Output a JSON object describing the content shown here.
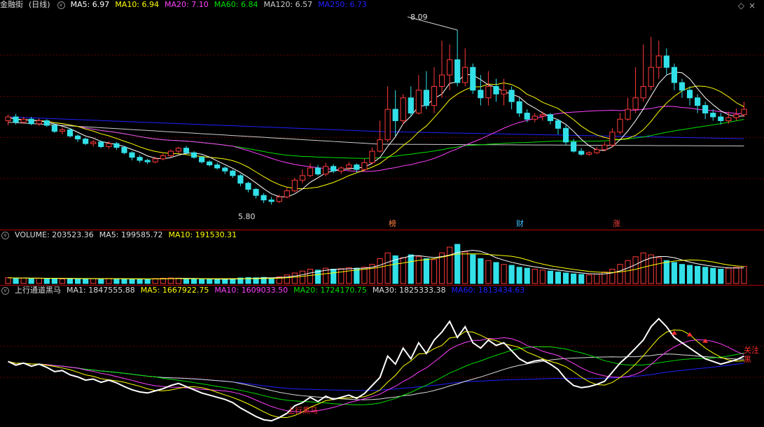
{
  "app": {
    "stock_name": "金融街",
    "period": "(日线)",
    "icon_collapse": "chevron-down-icon",
    "icon_settings": "diamond-icon"
  },
  "colors": {
    "up": "#ff3a3a",
    "down": "#32e0e8",
    "ma5": "#ffffff",
    "ma10": "#ffff00",
    "ma20": "#ff40ff",
    "ma60": "#00e000",
    "ma120": "#cccccc",
    "ma250": "#2020ff",
    "grid": "#6b0000"
  },
  "price_panel": {
    "legend": [
      {
        "key": "MA5",
        "label": "MA5: 6.97",
        "color": "#ffffff"
      },
      {
        "key": "MA10",
        "label": "MA10: 6.94",
        "color": "#ffff00"
      },
      {
        "key": "MA20",
        "label": "MA20: 7.10",
        "color": "#ff40ff"
      },
      {
        "key": "MA60",
        "label": "MA60: 6.84",
        "color": "#00e000"
      },
      {
        "key": "MA120",
        "label": "MA120: 6.57",
        "color": "#cccccc"
      },
      {
        "key": "MA250",
        "label": "MA250: 6.73",
        "color": "#2020ff"
      }
    ],
    "high_label": "8.09",
    "low_label": "5.80",
    "markers": [
      {
        "text": "榜",
        "color": "#ff8040"
      },
      {
        "text": "财",
        "color": "#40c0ff"
      },
      {
        "text": "涨",
        "color": "#ff4040"
      }
    ]
  },
  "volume_panel": {
    "legend": [
      {
        "key": "VOLUME",
        "label": "VOLUME: 203523.36",
        "color": "#dddddd"
      },
      {
        "key": "MA5",
        "label": "MA5: 199585.72",
        "color": "#dddddd"
      },
      {
        "key": "MA10",
        "label": "MA10: 191530.31",
        "color": "#ffff00"
      }
    ]
  },
  "indicator_panel": {
    "name": "上行通道黑马",
    "legend": [
      {
        "key": "MA1",
        "label": "MA1: 1847555.88",
        "color": "#dddddd"
      },
      {
        "key": "MA5",
        "label": "MA5: 1667922.75",
        "color": "#ffff00"
      },
      {
        "key": "MA10",
        "label": "MA10: 1609033.50",
        "color": "#ff40ff"
      },
      {
        "key": "MA20",
        "label": "MA20: 1724170.75",
        "color": "#00e000"
      },
      {
        "key": "MA30",
        "label": "MA30: 1825333.38",
        "color": "#dddddd"
      },
      {
        "key": "MA60",
        "label": "MA60: 1813434.63",
        "color": "#2020ff"
      }
    ],
    "label_left": "上行黑马",
    "label_right": "关注黑"
  },
  "chart_data": {
    "type": "candlestick",
    "price": {
      "ylim": [
        5.6,
        8.3
      ],
      "candles": [
        [
          6.9,
          6.95,
          6.84,
          6.98
        ],
        [
          6.95,
          6.88,
          6.85,
          6.99
        ],
        [
          6.88,
          6.92,
          6.86,
          6.95
        ],
        [
          6.92,
          6.86,
          6.84,
          6.95
        ],
        [
          6.86,
          6.9,
          6.83,
          6.93
        ],
        [
          6.9,
          6.84,
          6.82,
          6.92
        ],
        [
          6.84,
          6.76,
          6.74,
          6.86
        ],
        [
          6.76,
          6.78,
          6.72,
          6.81
        ],
        [
          6.78,
          6.7,
          6.68,
          6.8
        ],
        [
          6.7,
          6.66,
          6.62,
          6.72
        ],
        [
          6.66,
          6.6,
          6.58,
          6.68
        ],
        [
          6.6,
          6.62,
          6.56,
          6.65
        ],
        [
          6.62,
          6.56,
          6.54,
          6.64
        ],
        [
          6.56,
          6.6,
          6.53,
          6.63
        ],
        [
          6.6,
          6.55,
          6.52,
          6.62
        ],
        [
          6.55,
          6.48,
          6.46,
          6.57
        ],
        [
          6.48,
          6.42,
          6.38,
          6.5
        ],
        [
          6.42,
          6.38,
          6.35,
          6.45
        ],
        [
          6.38,
          6.36,
          6.33,
          6.4
        ],
        [
          6.36,
          6.4,
          6.34,
          6.43
        ],
        [
          6.4,
          6.44,
          6.38,
          6.47
        ],
        [
          6.44,
          6.5,
          6.42,
          6.52
        ],
        [
          6.5,
          6.54,
          6.47,
          6.56
        ],
        [
          6.54,
          6.48,
          6.46,
          6.57
        ],
        [
          6.48,
          6.42,
          6.4,
          6.5
        ],
        [
          6.42,
          6.36,
          6.34,
          6.44
        ],
        [
          6.36,
          6.32,
          6.3,
          6.38
        ],
        [
          6.32,
          6.28,
          6.26,
          6.35
        ],
        [
          6.28,
          6.24,
          6.2,
          6.3
        ],
        [
          6.24,
          6.18,
          6.15,
          6.26
        ],
        [
          6.18,
          6.08,
          6.04,
          6.2
        ],
        [
          6.08,
          6.0,
          5.96,
          6.1
        ],
        [
          6.0,
          5.92,
          5.88,
          6.02
        ],
        [
          5.92,
          5.86,
          5.82,
          5.95
        ],
        [
          5.86,
          5.84,
          5.8,
          5.9
        ],
        [
          5.84,
          5.9,
          5.82,
          5.93
        ],
        [
          5.9,
          5.98,
          5.88,
          6.02
        ],
        [
          5.98,
          6.12,
          5.96,
          6.15
        ],
        [
          6.12,
          6.18,
          6.08,
          6.26
        ],
        [
          6.18,
          6.28,
          6.16,
          6.34
        ],
        [
          6.28,
          6.2,
          6.18,
          6.32
        ],
        [
          6.2,
          6.3,
          6.17,
          6.35
        ],
        [
          6.3,
          6.24,
          6.21,
          6.33
        ],
        [
          6.24,
          6.28,
          6.2,
          6.3
        ],
        [
          6.28,
          6.32,
          6.24,
          6.36
        ],
        [
          6.32,
          6.26,
          6.22,
          6.34
        ],
        [
          6.26,
          6.35,
          6.24,
          6.4
        ],
        [
          6.35,
          6.5,
          6.33,
          6.55
        ],
        [
          6.5,
          6.65,
          6.48,
          6.9
        ],
        [
          6.65,
          7.05,
          6.62,
          7.35
        ],
        [
          7.05,
          6.9,
          6.7,
          7.3
        ],
        [
          6.9,
          7.2,
          6.85,
          7.25
        ],
        [
          7.2,
          7.0,
          6.95,
          7.35
        ],
        [
          7.0,
          7.3,
          6.98,
          7.5
        ],
        [
          7.3,
          7.1,
          7.05,
          7.55
        ],
        [
          7.1,
          7.35,
          7.0,
          7.6
        ],
        [
          7.35,
          7.5,
          7.2,
          7.95
        ],
        [
          7.5,
          7.7,
          7.3,
          7.9
        ],
        [
          7.7,
          7.4,
          7.35,
          8.09
        ],
        [
          7.4,
          7.6,
          7.35,
          7.85
        ],
        [
          7.6,
          7.3,
          7.25,
          7.65
        ],
        [
          7.3,
          7.2,
          7.1,
          7.5
        ],
        [
          7.2,
          7.35,
          7.1,
          7.55
        ],
        [
          7.35,
          7.25,
          7.15,
          7.45
        ],
        [
          7.25,
          7.3,
          7.1,
          7.45
        ],
        [
          7.3,
          7.15,
          7.05,
          7.35
        ],
        [
          7.15,
          7.0,
          6.95,
          7.2
        ],
        [
          7.0,
          6.92,
          6.88,
          7.05
        ],
        [
          6.92,
          6.96,
          6.88,
          7.0
        ],
        [
          6.96,
          6.98,
          6.9,
          7.02
        ],
        [
          6.98,
          6.9,
          6.85,
          7.0
        ],
        [
          6.9,
          6.8,
          6.72,
          6.92
        ],
        [
          6.8,
          6.62,
          6.58,
          6.84
        ],
        [
          6.62,
          6.5,
          6.48,
          6.66
        ],
        [
          6.5,
          6.46,
          6.44,
          6.54
        ],
        [
          6.46,
          6.48,
          6.44,
          6.5
        ],
        [
          6.48,
          6.52,
          6.46,
          6.56
        ],
        [
          6.52,
          6.58,
          6.5,
          6.62
        ],
        [
          6.58,
          6.75,
          6.55,
          6.8
        ],
        [
          6.75,
          6.92,
          6.72,
          7.0
        ],
        [
          6.92,
          7.05,
          6.9,
          7.2
        ],
        [
          7.05,
          7.2,
          7.0,
          7.6
        ],
        [
          7.2,
          7.35,
          7.15,
          7.9
        ],
        [
          7.35,
          7.6,
          7.3,
          8.0
        ],
        [
          7.6,
          7.75,
          7.45,
          7.95
        ],
        [
          7.75,
          7.6,
          7.5,
          7.85
        ],
        [
          7.6,
          7.4,
          7.3,
          7.65
        ],
        [
          7.4,
          7.3,
          7.2,
          7.45
        ],
        [
          7.3,
          7.2,
          7.1,
          7.35
        ],
        [
          7.2,
          7.1,
          7.0,
          7.25
        ],
        [
          7.1,
          7.0,
          6.92,
          7.15
        ],
        [
          7.0,
          6.95,
          6.9,
          7.05
        ],
        [
          6.95,
          6.9,
          6.85,
          7.0
        ],
        [
          6.9,
          6.94,
          6.86,
          7.02
        ],
        [
          6.94,
          6.98,
          6.9,
          7.06
        ],
        [
          6.98,
          7.05,
          6.95,
          7.15
        ]
      ]
    },
    "volume": {
      "values": [
        60,
        55,
        58,
        52,
        56,
        50,
        54,
        48,
        52,
        50,
        49,
        51,
        47,
        53,
        50,
        46,
        48,
        45,
        47,
        52,
        55,
        58,
        56,
        50,
        48,
        46,
        44,
        47,
        45,
        50,
        58,
        62,
        60,
        64,
        55,
        70,
        90,
        110,
        130,
        150,
        140,
        160,
        150,
        155,
        165,
        160,
        170,
        200,
        260,
        320,
        290,
        270,
        300,
        280,
        260,
        250,
        320,
        380,
        410,
        330,
        300,
        260,
        240,
        220,
        200,
        190,
        170,
        160,
        150,
        140,
        130,
        120,
        110,
        100,
        95,
        90,
        100,
        120,
        150,
        200,
        240,
        280,
        320,
        300,
        270,
        240,
        220,
        200,
        190,
        180,
        170,
        160,
        150,
        160,
        170,
        180
      ],
      "up_flags": [
        1,
        0,
        1,
        0,
        1,
        0,
        0,
        1,
        0,
        0,
        0,
        1,
        0,
        1,
        0,
        0,
        0,
        0,
        0,
        1,
        1,
        1,
        1,
        0,
        0,
        0,
        0,
        0,
        0,
        0,
        0,
        0,
        0,
        0,
        0,
        1,
        1,
        1,
        1,
        1,
        0,
        1,
        0,
        1,
        1,
        0,
        1,
        1,
        1,
        1,
        0,
        1,
        0,
        1,
        0,
        1,
        1,
        1,
        0,
        1,
        0,
        0,
        1,
        0,
        1,
        0,
        0,
        0,
        1,
        1,
        0,
        0,
        0,
        0,
        0,
        1,
        1,
        1,
        1,
        1,
        1,
        1,
        1,
        1,
        1,
        0,
        0,
        0,
        0,
        0,
        0,
        0,
        0,
        1,
        1,
        1
      ]
    },
    "indicator": {
      "series_labels": [
        "MA1",
        "MA5",
        "MA10",
        "MA20",
        "MA30",
        "MA60"
      ]
    }
  }
}
